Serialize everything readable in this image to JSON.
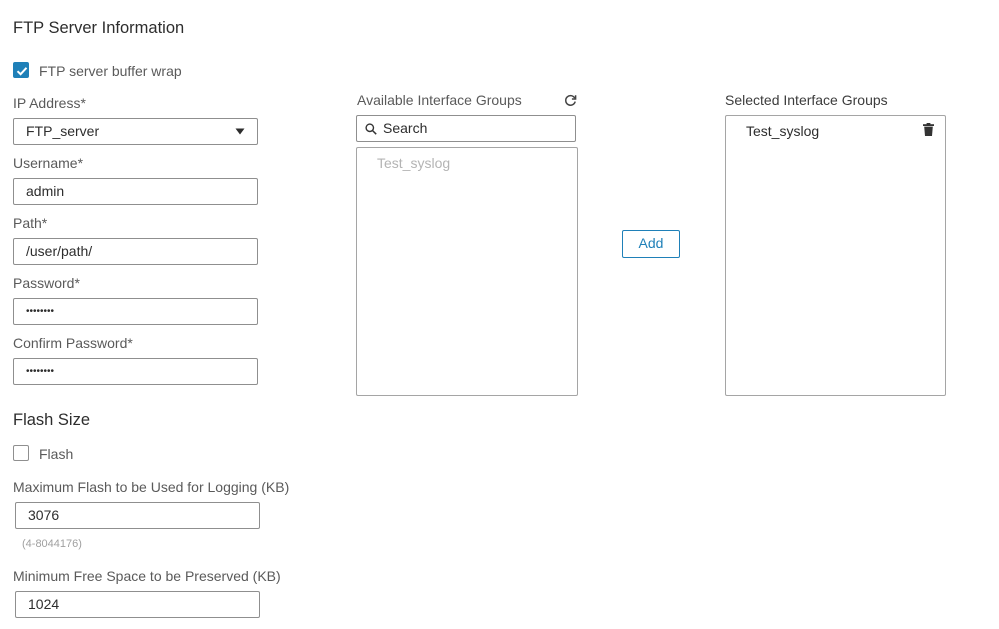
{
  "ftp": {
    "section_title": "FTP Server Information",
    "buffer_wrap": {
      "label": "FTP server buffer wrap",
      "checked": true
    },
    "ip_address": {
      "label": "IP Address*",
      "value": "FTP_server"
    },
    "username": {
      "label": "Username*",
      "value": "admin"
    },
    "path": {
      "label": "Path*",
      "value": "/user/path/"
    },
    "password": {
      "label": "Password*",
      "value": "••••••••"
    },
    "confirm_password": {
      "label": "Confirm Password*",
      "value": "••••••••"
    }
  },
  "interface_groups": {
    "available_title": "Available Interface Groups",
    "search_placeholder": "Search",
    "available_items": [
      "Test_syslog"
    ],
    "add_label": "Add",
    "selected_title": "Selected Interface Groups",
    "selected_items": [
      "Test_syslog"
    ]
  },
  "flash": {
    "section_title": "Flash Size",
    "flash_checkbox": {
      "label": "Flash",
      "checked": false
    },
    "max_flash": {
      "label": "Maximum Flash to be Used for Logging (KB)",
      "value": "3076",
      "range_hint": "(4-8044176)"
    },
    "min_free": {
      "label": "Minimum Free Space to be Preserved (KB)",
      "value": "1024"
    }
  },
  "colors": {
    "accent": "#1f80b8",
    "border": "#8f8f8f",
    "placeholder_text": "#b4b4b4"
  }
}
